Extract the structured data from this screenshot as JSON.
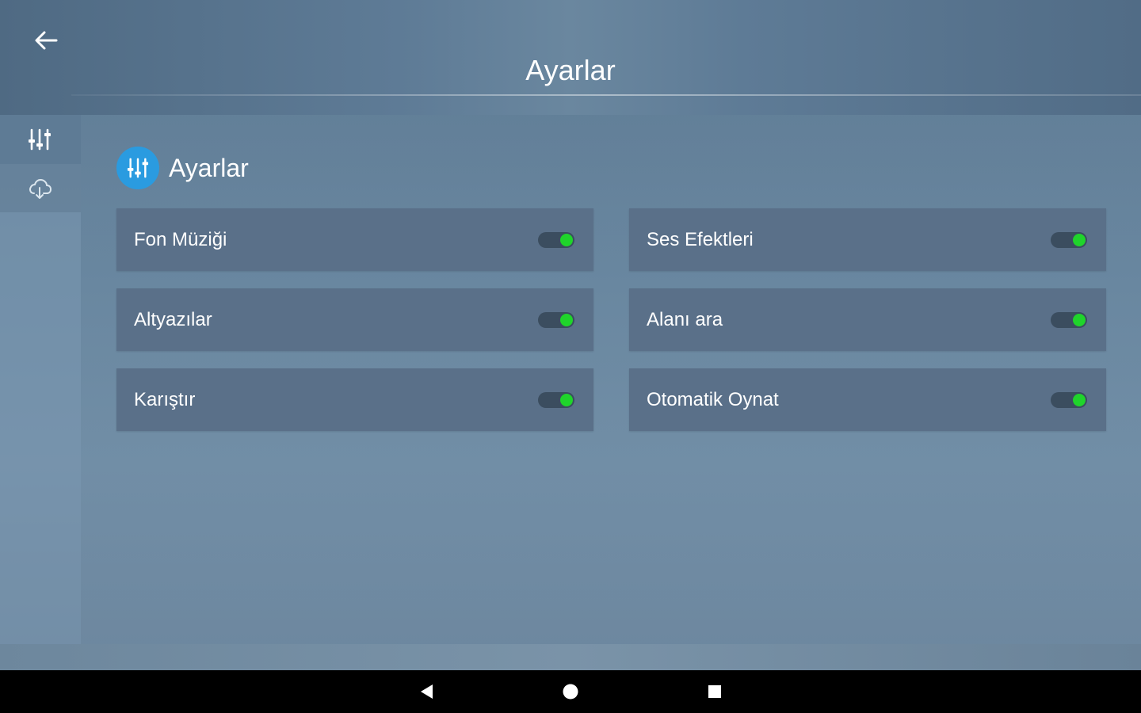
{
  "header": {
    "title": "Ayarlar",
    "back_icon": "arrow-left-icon"
  },
  "sidebar": {
    "tabs": [
      {
        "icon": "sliders-icon",
        "active": true
      },
      {
        "icon": "cloud-download-icon",
        "active": false
      }
    ]
  },
  "section": {
    "icon": "sliders-icon",
    "title": "Ayarlar",
    "icon_color": "#2a9be0"
  },
  "settings": [
    {
      "label": "Fon Müziği",
      "enabled": true
    },
    {
      "label": "Ses Efektleri",
      "enabled": true
    },
    {
      "label": "Altyazılar",
      "enabled": true
    },
    {
      "label": "Alanı ara",
      "enabled": true
    },
    {
      "label": "Karıştır",
      "enabled": true
    },
    {
      "label": "Otomatik Oynat",
      "enabled": true
    }
  ],
  "colors": {
    "toggle_on": "#1fd42b",
    "card_bg": "#5a7089"
  },
  "android_nav": {
    "buttons": [
      "back-triangle-icon",
      "home-circle-icon",
      "recents-square-icon"
    ]
  }
}
